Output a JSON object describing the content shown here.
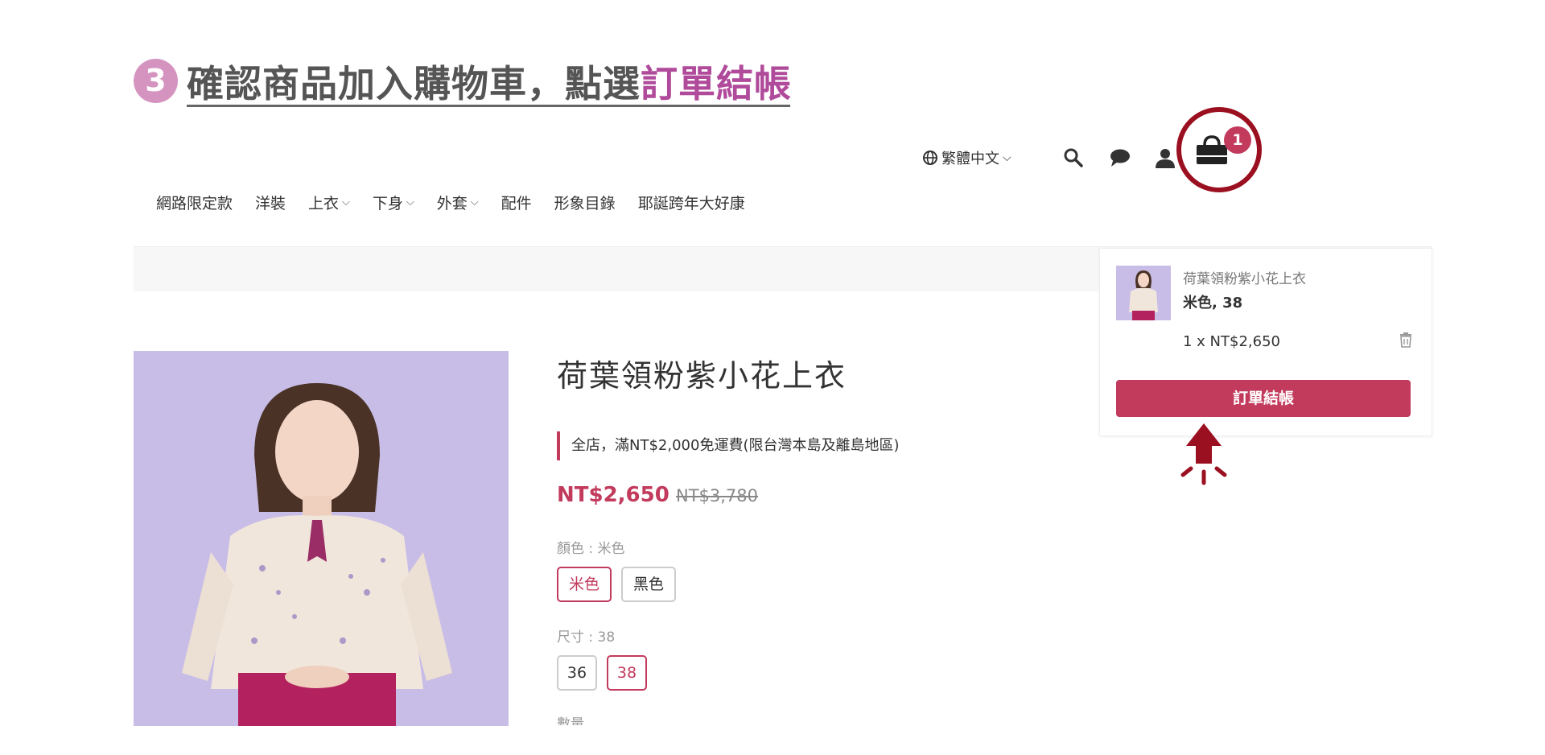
{
  "step": {
    "number": "3",
    "title_prefix": "確認商品加入購物車，點選",
    "title_highlight": "訂單結帳"
  },
  "header": {
    "language": "繁體中文",
    "cart_count": "1",
    "icons": [
      "globe-icon",
      "search-icon",
      "chat-icon",
      "user-icon",
      "shopping-bag-icon"
    ]
  },
  "nav": {
    "items": [
      {
        "label": "網路限定款",
        "dropdown": false
      },
      {
        "label": "洋裝",
        "dropdown": false
      },
      {
        "label": "上衣",
        "dropdown": true
      },
      {
        "label": "下身",
        "dropdown": true
      },
      {
        "label": "外套",
        "dropdown": true
      },
      {
        "label": "配件",
        "dropdown": false
      },
      {
        "label": "形象目錄",
        "dropdown": false
      },
      {
        "label": "耶誕跨年大好康",
        "dropdown": false
      }
    ]
  },
  "product": {
    "title": "荷葉領粉紫小花上衣",
    "promo": "全店，滿NT$2,000免運費(限台灣本島及離島地區)",
    "price": "NT$2,650",
    "original_price": "NT$3,780",
    "color_label": "顏色 : 米色",
    "colors": [
      {
        "label": "米色",
        "selected": true
      },
      {
        "label": "黑色",
        "selected": false
      }
    ],
    "size_label": "尺寸 : 38",
    "sizes": [
      {
        "label": "36",
        "selected": false
      },
      {
        "label": "38",
        "selected": true
      }
    ],
    "qty_label": "數量"
  },
  "cart": {
    "item_name": "荷葉領粉紫小花上衣",
    "item_variant": "米色, 38",
    "item_qty_price": "1 x  NT$2,650",
    "checkout_label": "訂單結帳"
  },
  "colors": {
    "accent": "#c23a5c",
    "highlight_circle": "#9b1020",
    "step_badge": "#d594c0",
    "step_highlight_text": "#b04a9a",
    "image_background": "#c8bde6"
  }
}
